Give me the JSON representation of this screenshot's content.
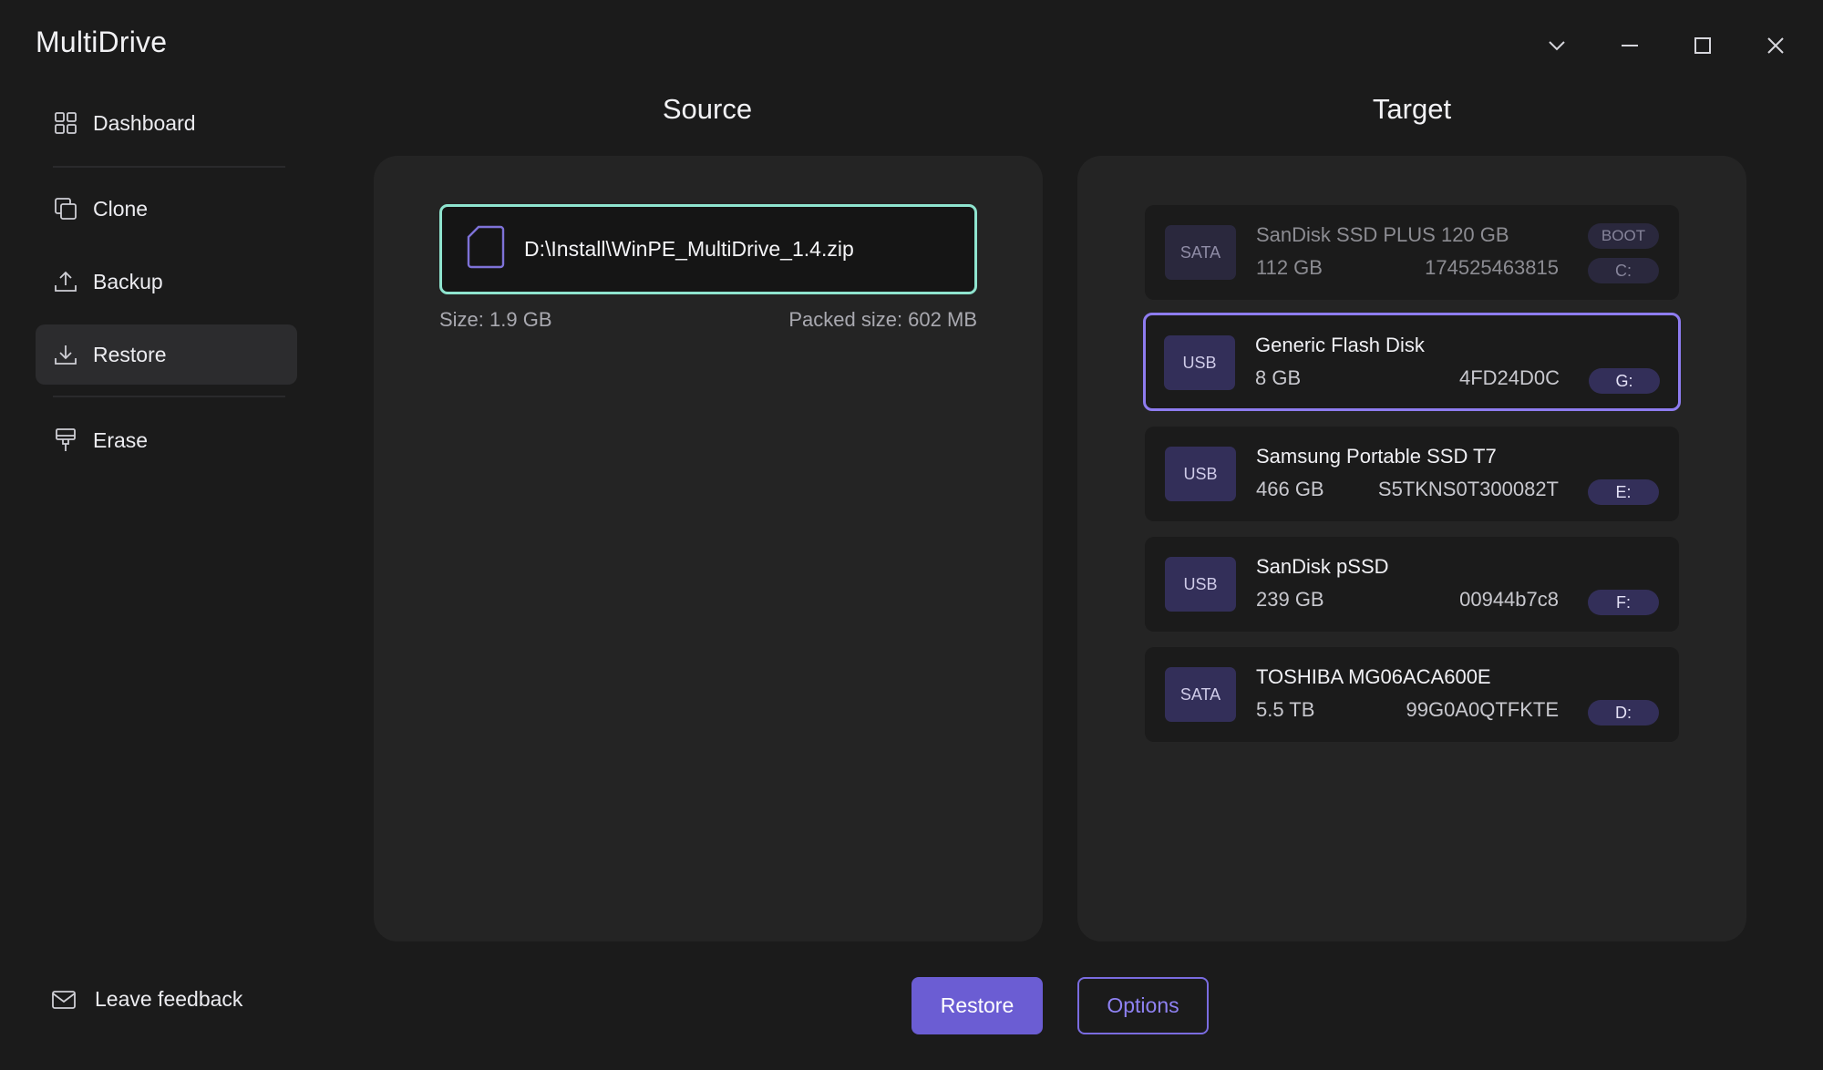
{
  "app": {
    "title": "MultiDrive"
  },
  "window_controls": [
    "chevron-down",
    "minimize",
    "maximize",
    "close"
  ],
  "sidebar": {
    "items": [
      {
        "label": "Dashboard",
        "icon": "grid-icon",
        "active": false
      },
      {
        "label": "Clone",
        "icon": "copy-icon",
        "active": false
      },
      {
        "label": "Backup",
        "icon": "upload-icon",
        "active": false
      },
      {
        "label": "Restore",
        "icon": "download-icon",
        "active": true
      },
      {
        "label": "Erase",
        "icon": "paint-brush-icon",
        "active": false
      }
    ],
    "feedback_label": "Leave feedback"
  },
  "source": {
    "title": "Source",
    "file_path": "D:\\Install\\WinPE_MultiDrive_1.4.zip",
    "size_label": "Size: 1.9 GB",
    "packed_size_label": "Packed size: 602 MB"
  },
  "target": {
    "title": "Target",
    "drives": [
      {
        "interface": "SATA",
        "name": "SanDisk SSD PLUS 120 GB",
        "capacity": "112 GB",
        "serial": "174525463815",
        "letter": "C:",
        "badge": "BOOT",
        "state": "disabled"
      },
      {
        "interface": "USB",
        "name": "Generic Flash Disk",
        "capacity": "8 GB",
        "serial": "4FD24D0C",
        "letter": "G:",
        "state": "selected"
      },
      {
        "interface": "USB",
        "name": "Samsung Portable SSD T7",
        "capacity": "466 GB",
        "serial": "S5TKNS0T300082T",
        "letter": "E:",
        "state": "normal"
      },
      {
        "interface": "USB",
        "name": "SanDisk pSSD",
        "capacity": "239 GB",
        "serial": "00944b7c8",
        "letter": "F:",
        "state": "normal"
      },
      {
        "interface": "SATA",
        "name": "TOSHIBA MG06ACA600E",
        "capacity": "5.5 TB",
        "serial": "99G0A0QTFKTE",
        "letter": "D:",
        "state": "normal"
      }
    ]
  },
  "actions": {
    "primary_label": "Restore",
    "secondary_label": "Options"
  },
  "colors": {
    "accent": "#6b5dd3",
    "source_border": "#8fe4cf",
    "selected_border": "#8e7cf0",
    "background": "#1b1b1b"
  }
}
